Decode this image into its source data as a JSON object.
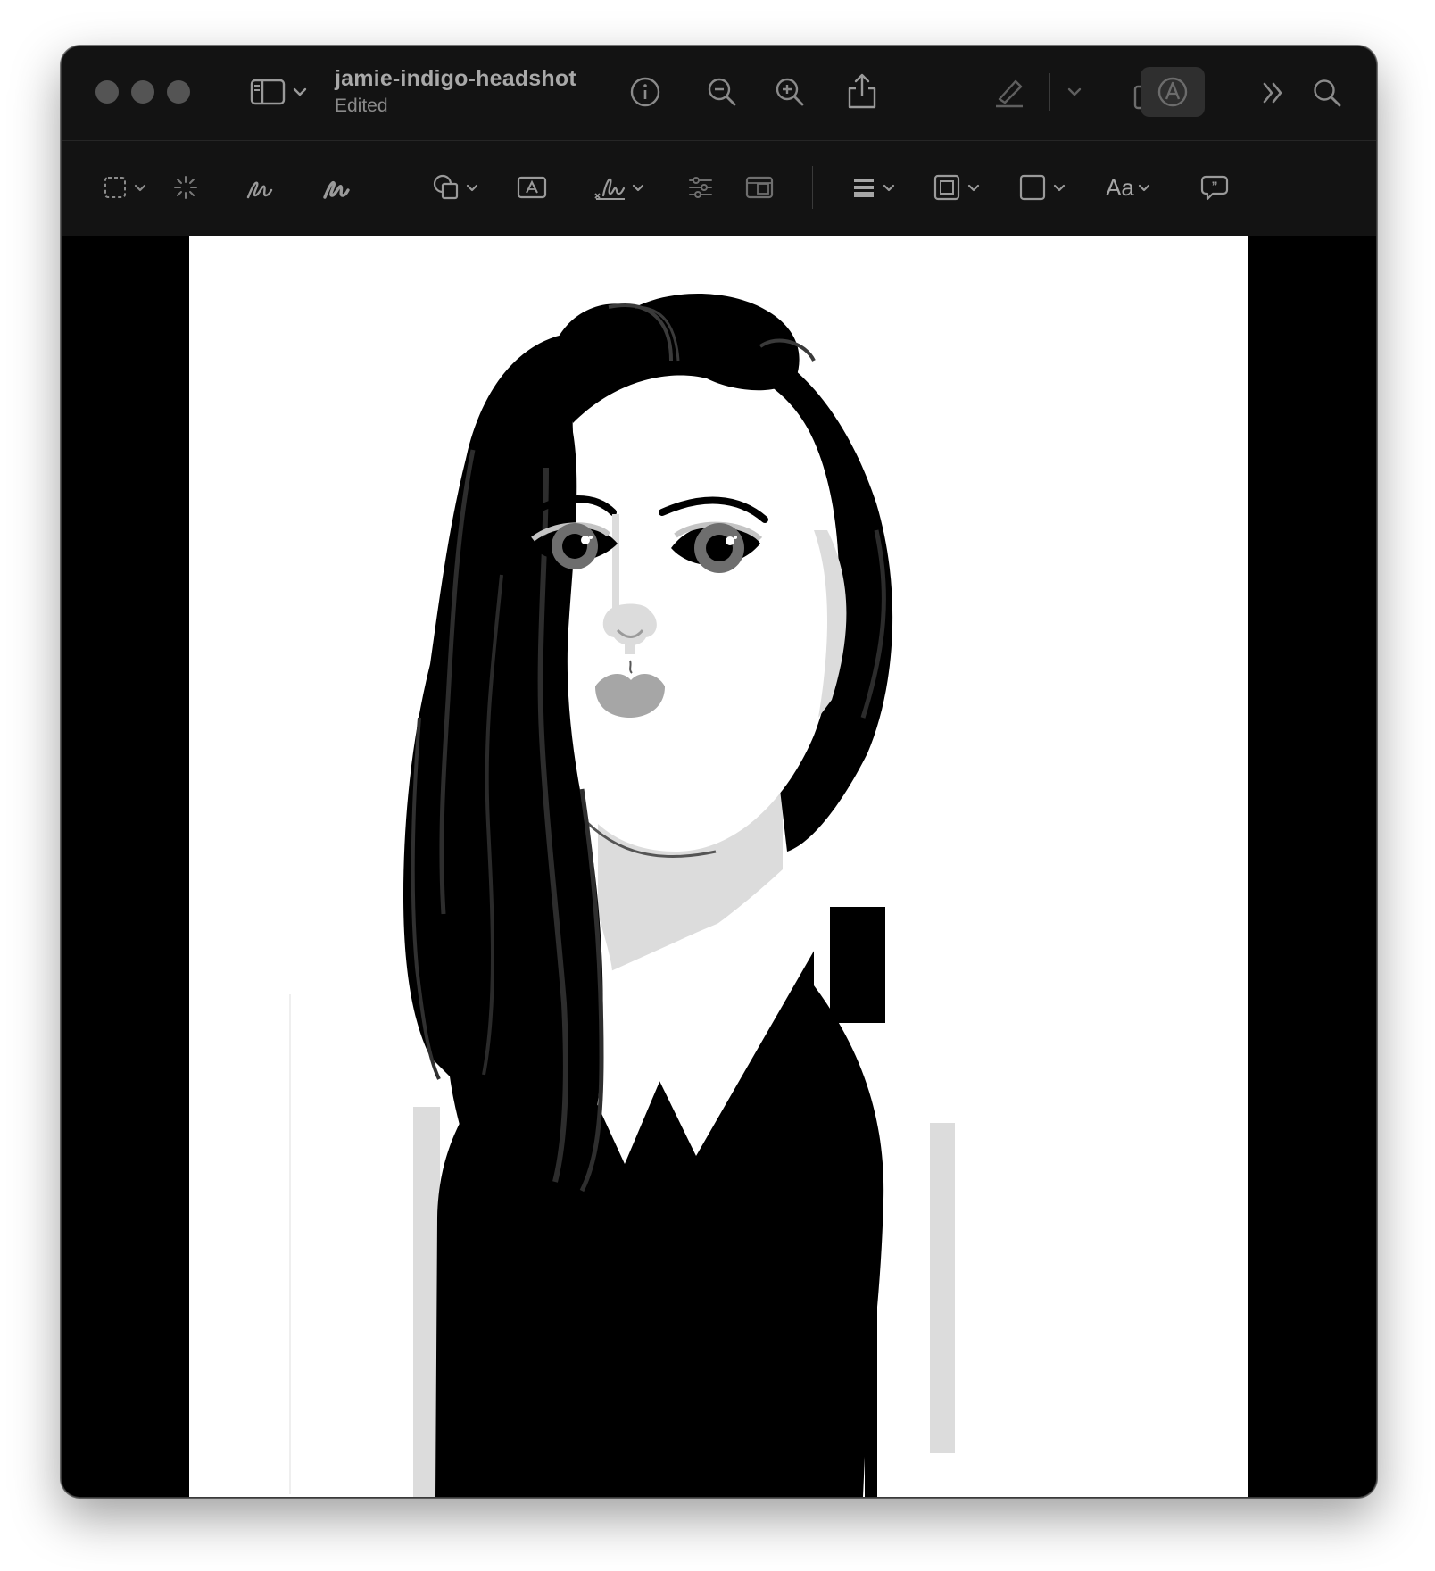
{
  "window": {
    "title": "jamie-indigo-headshot",
    "subtitle": "Edited"
  },
  "titlebar": {
    "controls": [
      "close",
      "minimize",
      "zoom"
    ],
    "buttons": [
      "sidebar-toggle",
      "info",
      "zoom-out",
      "zoom-in",
      "share",
      "highlight",
      "highlight-menu",
      "rotate",
      "markup",
      "more",
      "search"
    ]
  },
  "markup_toolbar": {
    "tools": [
      "selection",
      "instant-alpha",
      "sketch",
      "draw",
      "shapes",
      "text-box",
      "signature",
      "adjust-color",
      "adjust-size",
      "line-style",
      "border-color",
      "fill-color",
      "text-style",
      "annotate"
    ],
    "text_style_label": "Aa"
  },
  "document": {
    "type": "image",
    "subject": "illustrated portrait",
    "palette": {
      "background": "#ffffff",
      "hair": "#000000",
      "skin": "#ffffff",
      "shadow": "#dcdcdc",
      "iris": "#6e6e6e",
      "lips": "#a6a6a6",
      "top": "#000000"
    }
  }
}
